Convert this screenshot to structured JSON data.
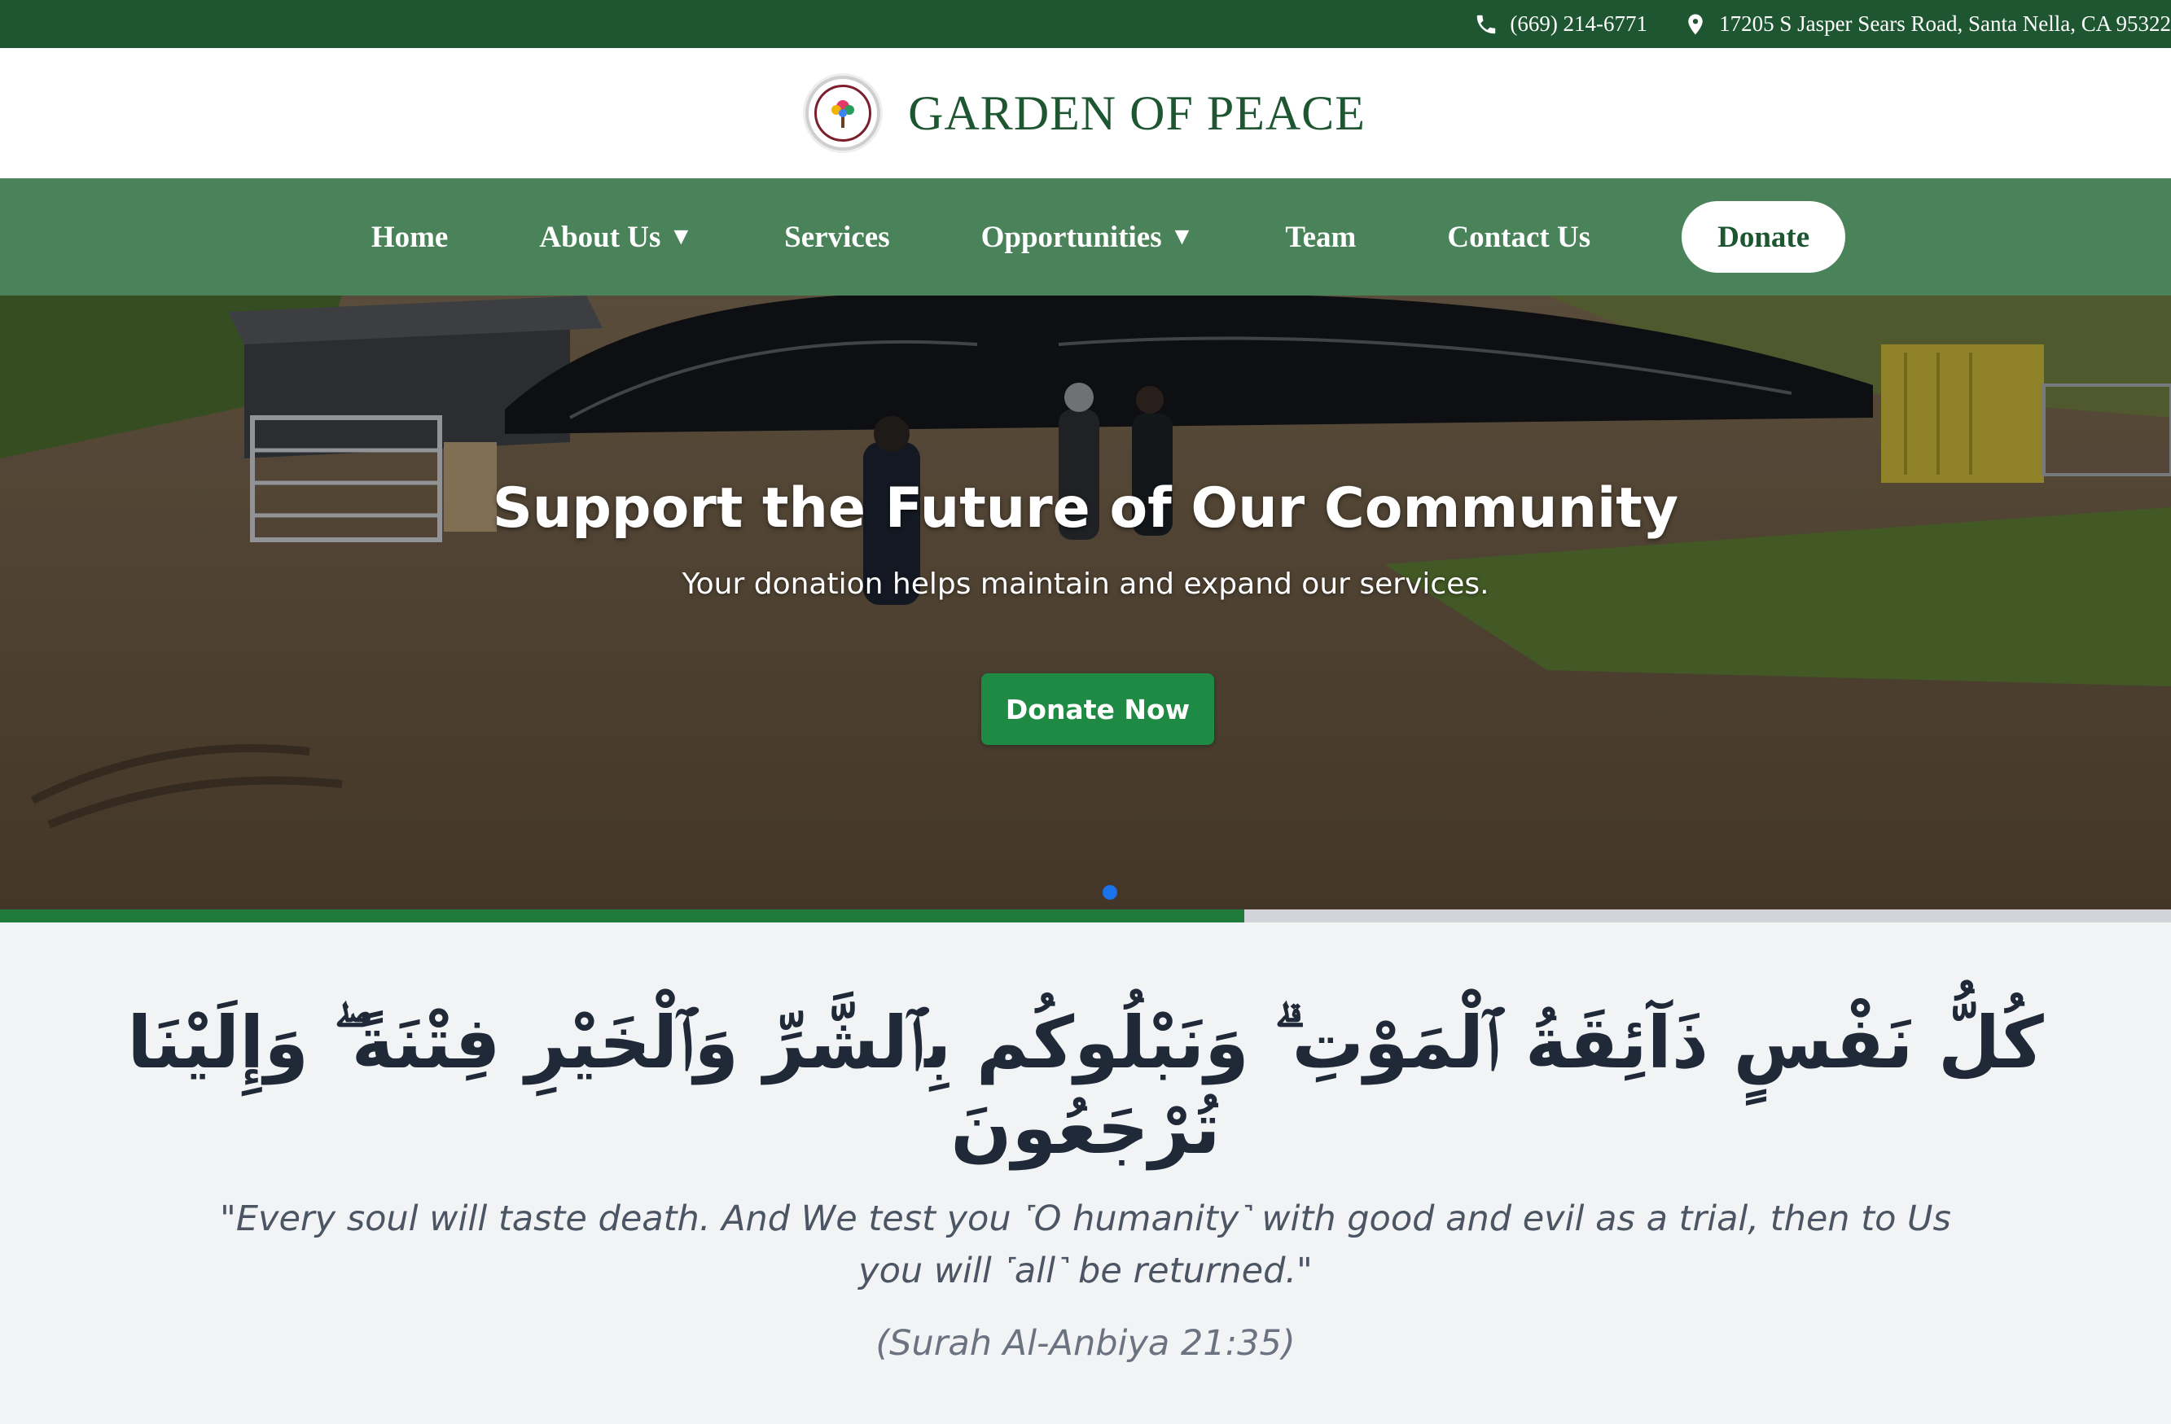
{
  "topbar": {
    "phone": "(669) 214-6771",
    "address": "17205 S Jasper Sears Road, Santa Nella, CA 95322"
  },
  "brand": {
    "title": "GARDEN OF PEACE"
  },
  "nav": {
    "items": [
      {
        "label": "Home",
        "has_dropdown": false
      },
      {
        "label": "About Us",
        "has_dropdown": true
      },
      {
        "label": "Services",
        "has_dropdown": false
      },
      {
        "label": "Opportunities",
        "has_dropdown": true
      },
      {
        "label": "Team",
        "has_dropdown": false
      },
      {
        "label": "Contact Us",
        "has_dropdown": false
      }
    ],
    "caret": "▼",
    "donate_label": "Donate"
  },
  "hero": {
    "title": "Support the Future of Our Community",
    "subtitle": "Your donation helps maintain and expand our services.",
    "button_label": "Donate Now"
  },
  "slider": {
    "progress_fraction": 0.573
  },
  "quote": {
    "arabic": "كُلُّ نَفْسٍ ذَآئِقَةُ ٱلْمَوْتِ ۗ وَنَبْلُوكُم بِٱلشَّرِّ وَٱلْخَيْرِ فِتْنَةً ۖ وَإِلَيْنَا تُرْجَعُونَ",
    "translation": "\"Every soul will taste death. And We test you ˹O humanity˺ with good and evil as a trial, then to Us you will ˹all˺ be returned.\"",
    "reference": "(Surah Al-Anbiya 21:35)"
  },
  "colors": {
    "topbar": "#1d5630",
    "nav": "#4a8359",
    "brand_text": "#1d5630",
    "hero_button": "#1f8a43",
    "progress_fill": "#1f7a3a",
    "progress_track": "#d3d4d9",
    "slider_dot": "#1a73e8"
  },
  "icons": {
    "phone": "phone-icon",
    "location": "map-pin-icon",
    "logo": "garden-of-peace-logo"
  }
}
